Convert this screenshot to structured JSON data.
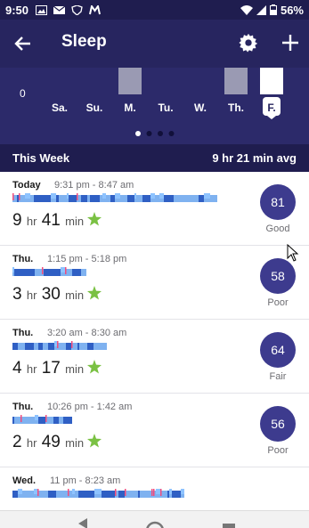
{
  "status_bar": {
    "time": "9:50",
    "battery": "56%",
    "icons": [
      "image-icon",
      "mail-icon",
      "shield-icon",
      "m-logo-icon",
      "wifi-icon",
      "signal-icon",
      "battery-icon"
    ]
  },
  "header": {
    "title": "Sleep",
    "back_icon": "back-arrow-icon",
    "settings_icon": "gear-icon",
    "add_icon": "plus-icon"
  },
  "week_chart": {
    "axis_zero_label": "0",
    "days": [
      {
        "label": "Sa.",
        "has_bar": false,
        "level": 0
      },
      {
        "label": "Su.",
        "has_bar": false,
        "level": 0
      },
      {
        "label": "M.",
        "has_bar": true,
        "level": 0.75
      },
      {
        "label": "Tu.",
        "has_bar": false,
        "level": 0
      },
      {
        "label": "W.",
        "has_bar": false,
        "level": 0
      },
      {
        "label": "Th.",
        "has_bar": true,
        "level": 0.75
      },
      {
        "label": "F.",
        "has_bar": true,
        "level": 0.75,
        "selected": true
      }
    ],
    "page_dots": 4,
    "active_dot": 0
  },
  "week_summary": {
    "label": "This Week",
    "average": "9 hr 21 min avg"
  },
  "logs": [
    {
      "day": "Today",
      "range": "9:31 pm - 8:47 am",
      "hours": "9",
      "hr_unit": "hr",
      "minutes": "41",
      "min_unit": "min",
      "score": "81",
      "rating": "Good",
      "graph_fraction": 1.0
    },
    {
      "day": "Thu.",
      "range": "1:15 pm - 5:18 pm",
      "hours": "3",
      "hr_unit": "hr",
      "minutes": "30",
      "min_unit": "min",
      "score": "58",
      "rating": "Poor",
      "graph_fraction": 0.36
    },
    {
      "day": "Thu.",
      "range": "3:20 am - 8:30 am",
      "hours": "4",
      "hr_unit": "hr",
      "minutes": "17",
      "min_unit": "min",
      "score": "64",
      "rating": "Fair",
      "graph_fraction": 0.46
    },
    {
      "day": "Thu.",
      "range": "10:26 pm - 1:42 am",
      "hours": "2",
      "hr_unit": "hr",
      "minutes": "49",
      "min_unit": "min",
      "score": "56",
      "rating": "Poor",
      "graph_fraction": 0.29
    },
    {
      "day": "Wed.",
      "range": "11 pm - 8:23 am",
      "hours": "",
      "hr_unit": "",
      "minutes": "",
      "min_unit": "",
      "score": "",
      "rating": "",
      "graph_fraction": 0.84
    }
  ],
  "colors": {
    "header": "#27255f",
    "chart_bg": "#2c2a6a",
    "score_circle": "#3d3b8e",
    "stage_light": "#7fb2f0",
    "stage_deep": "#2f5fc4",
    "stage_rem": "#8ec3ff",
    "stage_awake": "#f24c7c",
    "star": "#7ac143"
  }
}
